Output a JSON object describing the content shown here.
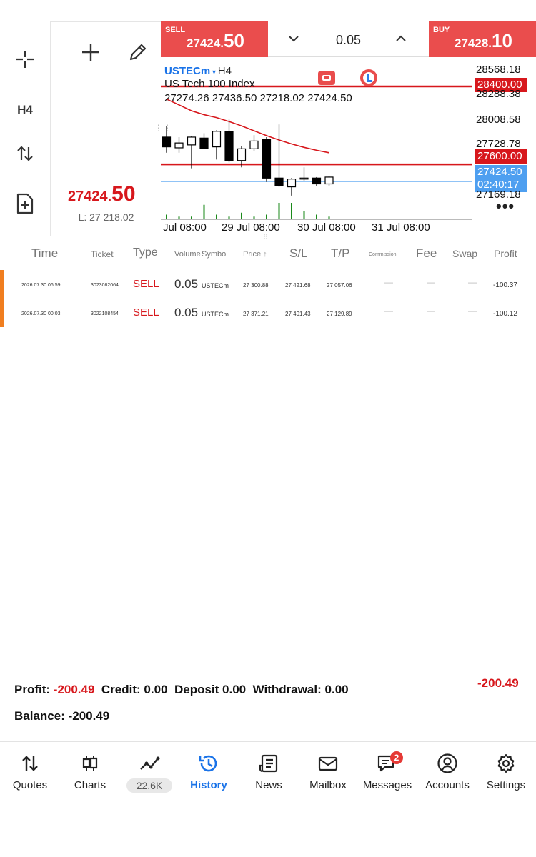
{
  "toolbar": {
    "timeframe": "H4"
  },
  "order_panel": {
    "bid_small": "27424.",
    "bid_big": "50",
    "low_label": "L: 27 218.02"
  },
  "trade_bar": {
    "sell_label": "SELL",
    "sell_small": "27424.",
    "sell_big": "50",
    "buy_label": "BUY",
    "buy_small": "27428.",
    "buy_big": "10",
    "volume": "0.05"
  },
  "chart": {
    "symbol": "USTECm",
    "timeframe": "H4",
    "full_name": "US Tech 100 Index",
    "ohlc": "27274.26 27436.50 27218.02 27424.50",
    "price_ticks": [
      "28568.18",
      "28288.38",
      "28008.58",
      "27728.78",
      "27169.18"
    ],
    "line_tag_1": "28400.00",
    "line_tag_2": "27600.00",
    "current_price_tag": "27424.50",
    "countdown": "02:40:17",
    "x_labels": [
      "Jul 08:00",
      "29 Jul 08:00",
      "30 Jul 08:00",
      "31 Jul 08:00"
    ]
  },
  "chart_data": {
    "type": "candlestick",
    "ylim": [
      27030,
      28700
    ],
    "horizontal_lines": [
      28400.0,
      27600.0
    ],
    "current_price": 27424.5,
    "candles": [
      {
        "o": 27880,
        "h": 27990,
        "l": 27720,
        "c": 27780
      },
      {
        "o": 27770,
        "h": 27880,
        "l": 27720,
        "c": 27820
      },
      {
        "o": 27800,
        "h": 27890,
        "l": 27560,
        "c": 27880
      },
      {
        "o": 27870,
        "h": 27920,
        "l": 27780,
        "c": 27760
      },
      {
        "o": 27780,
        "h": 27950,
        "l": 27650,
        "c": 27940
      },
      {
        "o": 27940,
        "h": 28060,
        "l": 27620,
        "c": 27640
      },
      {
        "o": 27640,
        "h": 27790,
        "l": 27570,
        "c": 27760
      },
      {
        "o": 27760,
        "h": 27900,
        "l": 27740,
        "c": 27840
      },
      {
        "o": 27860,
        "h": 27880,
        "l": 27420,
        "c": 27460
      },
      {
        "o": 27460,
        "h": 28010,
        "l": 27370,
        "c": 27380
      },
      {
        "o": 27370,
        "h": 27460,
        "l": 27280,
        "c": 27450
      },
      {
        "o": 27450,
        "h": 27570,
        "l": 27430,
        "c": 27460
      },
      {
        "o": 27460,
        "h": 27470,
        "l": 27380,
        "c": 27400
      },
      {
        "o": 27400,
        "h": 27480,
        "l": 27380,
        "c": 27470
      }
    ],
    "ma": [
      28270,
      28210,
      28150,
      28110,
      28080,
      28040,
      27995,
      27945,
      27895,
      27850,
      27810,
      27775,
      27745,
      27720
    ],
    "volumes": [
      2,
      1,
      1,
      7,
      2,
      1,
      3,
      1,
      2,
      8,
      8,
      4,
      2,
      1
    ]
  },
  "table": {
    "headers": [
      "Time",
      "Ticket",
      "Type",
      "Volume",
      "Symbol",
      "Price",
      "S/L",
      "T/P",
      "Commission",
      "Fee",
      "Swap",
      "Profit"
    ],
    "rows": [
      {
        "time": "2026.07.30 06:59",
        "ticket": "3023082064",
        "type": "SELL",
        "volume": "0.05",
        "symbol": "USTECm",
        "price": "27 300.88",
        "sl": "27 421.68",
        "tp": "27 057.06",
        "commission": "—",
        "fee": "—",
        "swap": "—",
        "profit": "-100.37"
      },
      {
        "time": "2026.07.30 00:03",
        "ticket": "3022108454",
        "type": "SELL",
        "volume": "0.05",
        "symbol": "USTECm",
        "price": "27 371.21",
        "sl": "27 491.43",
        "tp": "27 129.89",
        "commission": "—",
        "fee": "—",
        "swap": "—",
        "profit": "-100.12"
      }
    ]
  },
  "summary": {
    "profit_label": "Profit:",
    "profit": "-200.49",
    "credit_label": "Credit:",
    "credit": "0.00",
    "deposit_label": "Deposit",
    "deposit": "0.00",
    "withdrawal_label": "Withdrawal:",
    "withdrawal": "0.00",
    "total": "-200.49",
    "balance_label": "Balance:",
    "balance": "-200.49"
  },
  "nav": {
    "quotes": "Quotes",
    "charts": "Charts",
    "trade_pill": "22.6K",
    "history": "History",
    "news": "News",
    "mailbox": "Mailbox",
    "messages": "Messages",
    "messages_badge": "2",
    "accounts": "Accounts",
    "settings": "Settings"
  },
  "colors": {
    "sell": "#ea4d4d",
    "accent": "#1a73e8",
    "price_red": "#d7171c"
  }
}
